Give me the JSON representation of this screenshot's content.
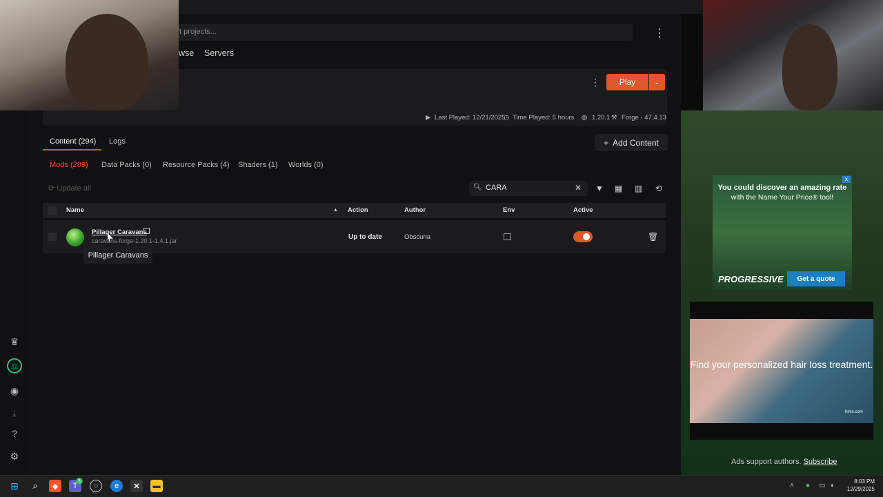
{
  "top": {
    "search_placeholder": "ft projects...",
    "nav": [
      "wse",
      "Servers"
    ]
  },
  "instance": {
    "play_label": "Play",
    "last_played": "Last Played: 12/21/2025",
    "time_played": "Time Played: 5 hours",
    "version": "1.20.1",
    "loader": "Forge - 47.4.13"
  },
  "tabs": {
    "content": "Content (294)",
    "logs": "Logs",
    "add_content": "Add Content"
  },
  "subtabs": {
    "mods": "Mods (289)",
    "data_packs": "Data Packs (0)",
    "resource_packs": "Resource Packs (4)",
    "shaders": "Shaders (1)",
    "worlds": "Worlds (0)"
  },
  "toolbar": {
    "update_all": "Update all",
    "filter_value": "CARA"
  },
  "table": {
    "headers": {
      "name": "Name",
      "action": "Action",
      "author": "Author",
      "env": "Env",
      "active": "Active"
    },
    "rows": [
      {
        "name": "Pillager Caravans",
        "file": "caravans-forge-1.20.1-1.4.1.jar",
        "action": "Up to date",
        "author": "Obscuria",
        "active": true
      }
    ]
  },
  "tooltip": "Pillager Caravans",
  "ads": {
    "ad1_title": "You could discover an amazing rate",
    "ad1_sub": "with the Name Your Price® tool!",
    "ad1_brand": "PROGRESSIVE",
    "ad1_cta": "Get a quote",
    "ad2_text": "Find your personalized hair loss treatment.",
    "ad2_brand": "hims.com",
    "note": "Ads support authors.",
    "subscribe": "Subscribe"
  },
  "taskbar": {
    "time": "8:03 PM",
    "date": "12/29/2025",
    "badge": "3"
  },
  "colors": {
    "accent": "#e0572a",
    "bg": "#111113",
    "panel": "#1b1b1e"
  }
}
